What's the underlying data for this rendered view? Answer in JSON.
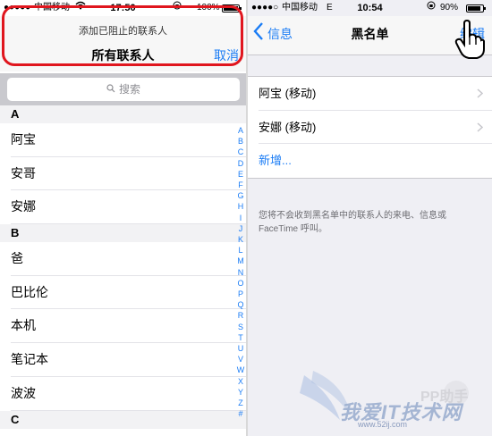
{
  "left": {
    "status": {
      "carrier": "中国移动",
      "time": "17:50",
      "battery_text": "100%",
      "battery_level": 1.0
    },
    "prompt": "添加已阻止的联系人",
    "title": "所有联系人",
    "cancel_label": "取消",
    "search_placeholder": "搜索",
    "sections": [
      {
        "letter": "A",
        "rows": [
          "阿宝",
          "安哥",
          "安娜"
        ]
      },
      {
        "letter": "B",
        "rows": [
          "爸",
          "巴比伦",
          "本机",
          "笔记本",
          "波波"
        ]
      },
      {
        "letter": "C",
        "rows": []
      }
    ],
    "index": [
      "A",
      "B",
      "C",
      "D",
      "E",
      "F",
      "G",
      "H",
      "I",
      "J",
      "K",
      "L",
      "M",
      "N",
      "O",
      "P",
      "Q",
      "R",
      "S",
      "T",
      "U",
      "V",
      "W",
      "X",
      "Y",
      "Z",
      "#"
    ]
  },
  "right": {
    "status": {
      "carrier": "中国移动",
      "network": "E",
      "time": "10:54",
      "battery_text": "90%",
      "battery_level": 0.9
    },
    "back_label": "信息",
    "title": "黑名单",
    "edit_label": "编辑",
    "blocked": [
      "阿宝 (移动)",
      "安娜 (移动)"
    ],
    "add_label": "新增...",
    "note": "您将不会收到黑名单中的联系人的来电、信息或 FaceTime 呼叫。"
  },
  "watermark": {
    "text": "我爱IT技术网",
    "url": "www.52ij.com",
    "brand": "PP助手"
  },
  "colors": {
    "accent": "#1a7cf5",
    "highlight": "#e0161e"
  },
  "icons": [
    "signal-dots-icon",
    "wifi-icon",
    "lock-rotation-icon",
    "battery-icon",
    "magnifier-icon",
    "back-chevron-icon",
    "disclosure-chevron-icon",
    "pointing-hand-icon"
  ]
}
